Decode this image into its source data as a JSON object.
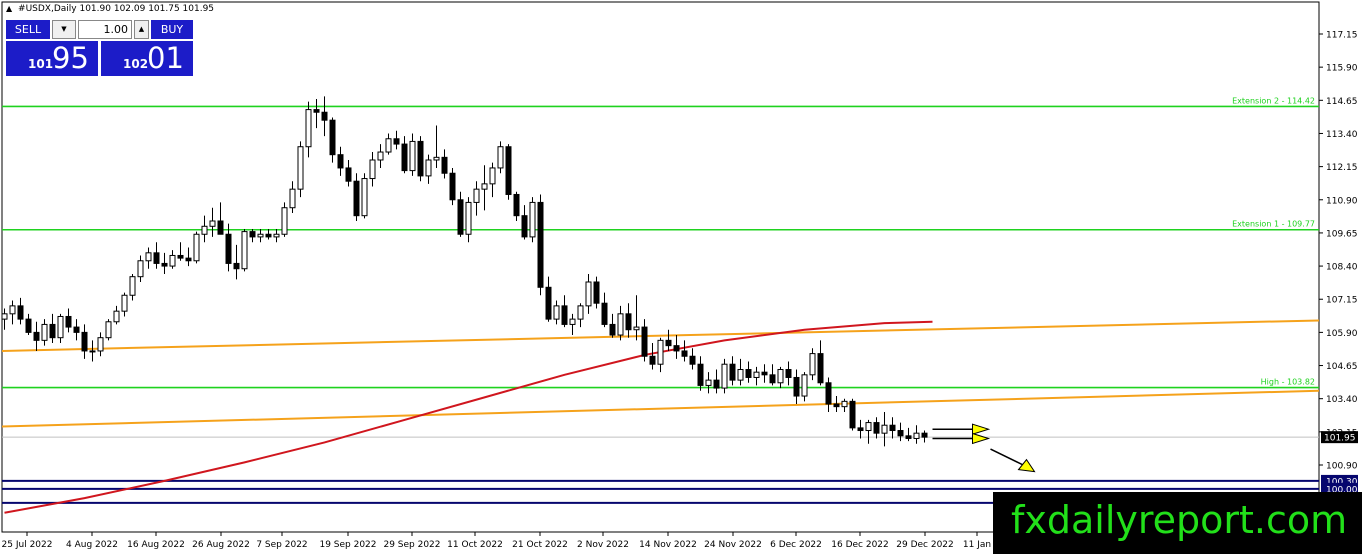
{
  "header": {
    "symbol_timeframe": "#USDX,Daily",
    "ohlc": "101.90 102.09 101.75 101.95"
  },
  "trade_panel": {
    "sell_label": "SELL",
    "buy_label": "BUY",
    "volume": "1.00",
    "bid_prefix": "101",
    "bid_big": "95",
    "ask_prefix": "102",
    "ask_big": "01"
  },
  "watermark": "fxdailyreport.com",
  "colors": {
    "background": "#ffffff",
    "candle": "#000000",
    "level_green": "#1fd21f",
    "trendline_orange": "#f5a21b",
    "moving_average_red": "#d0161e",
    "support_navy": "#06066e",
    "panel_blue": "#1c1cc8",
    "arrow_yellow": "#ffff00"
  },
  "chart_data": {
    "type": "candlestick",
    "symbol": "#USDX",
    "timeframe": "Daily",
    "current_price": 101.95,
    "ylim": [
      99.5,
      117.6
    ],
    "y_ticks": [
      117.15,
      115.9,
      114.65,
      113.4,
      112.15,
      110.9,
      109.65,
      108.4,
      107.15,
      105.9,
      104.65,
      103.4,
      102.15,
      100.9,
      100.3,
      100.0
    ],
    "y_tick_labels": [
      "117.15",
      "115.90",
      "114.65",
      "113.40",
      "112.15",
      "110.90",
      "109.65",
      "108.40",
      "107.15",
      "105.90",
      "104.65",
      "103.40",
      "102.15",
      "100.90",
      "100.30",
      "100.00",
      "101.95"
    ],
    "x_labels": [
      "25 Jul 2022",
      "4 Aug 2022",
      "16 Aug 2022",
      "26 Aug 2022",
      "7 Sep 2022",
      "19 Sep 2022",
      "29 Sep 2022",
      "11 Oct 2022",
      "21 Oct 2022",
      "2 Nov 2022",
      "14 Nov 2022",
      "24 Nov 2022",
      "6 Dec 2022",
      "16 Dec 2022",
      "29 Dec 2022",
      "11 Jan"
    ],
    "ohlc": [
      [
        106.4,
        106.8,
        106.0,
        106.6
      ],
      [
        106.6,
        107.1,
        106.2,
        106.9
      ],
      [
        106.9,
        107.2,
        106.2,
        106.4
      ],
      [
        106.4,
        106.6,
        105.8,
        105.9
      ],
      [
        105.9,
        106.3,
        105.2,
        105.6
      ],
      [
        105.6,
        106.4,
        105.4,
        106.2
      ],
      [
        106.2,
        106.6,
        105.5,
        105.7
      ],
      [
        105.7,
        106.6,
        105.5,
        106.5
      ],
      [
        106.5,
        106.8,
        105.9,
        106.1
      ],
      [
        106.1,
        106.4,
        105.6,
        105.9
      ],
      [
        105.9,
        106.2,
        104.9,
        105.2
      ],
      [
        105.2,
        105.6,
        104.8,
        105.2
      ],
      [
        105.2,
        105.9,
        105.0,
        105.7
      ],
      [
        105.7,
        106.4,
        105.6,
        106.3
      ],
      [
        106.3,
        106.9,
        106.2,
        106.7
      ],
      [
        106.7,
        107.4,
        106.5,
        107.3
      ],
      [
        107.3,
        108.1,
        107.1,
        108.0
      ],
      [
        108.0,
        108.8,
        107.8,
        108.6
      ],
      [
        108.6,
        109.1,
        108.3,
        108.9
      ],
      [
        108.9,
        109.3,
        108.3,
        108.5
      ],
      [
        108.5,
        108.9,
        108.1,
        108.4
      ],
      [
        108.4,
        109.0,
        108.3,
        108.8
      ],
      [
        108.8,
        109.3,
        108.6,
        108.7
      ],
      [
        108.7,
        109.1,
        108.4,
        108.6
      ],
      [
        108.6,
        109.7,
        108.5,
        109.6
      ],
      [
        109.6,
        110.3,
        109.3,
        109.9
      ],
      [
        109.9,
        110.6,
        109.5,
        110.1
      ],
      [
        110.1,
        110.8,
        109.8,
        109.6
      ],
      [
        109.6,
        110.0,
        108.2,
        108.5
      ],
      [
        108.5,
        109.2,
        107.9,
        108.3
      ],
      [
        108.3,
        109.8,
        108.2,
        109.7
      ],
      [
        109.7,
        109.8,
        109.3,
        109.5
      ],
      [
        109.5,
        109.8,
        109.3,
        109.6
      ],
      [
        109.6,
        109.8,
        109.4,
        109.5
      ],
      [
        109.5,
        109.8,
        109.3,
        109.6
      ],
      [
        109.6,
        110.8,
        109.5,
        110.6
      ],
      [
        110.6,
        111.6,
        110.4,
        111.3
      ],
      [
        111.3,
        113.1,
        111.0,
        112.9
      ],
      [
        112.9,
        114.6,
        112.5,
        114.3
      ],
      [
        114.3,
        114.7,
        113.6,
        114.2
      ],
      [
        114.2,
        114.8,
        113.3,
        113.9
      ],
      [
        113.9,
        114.0,
        112.3,
        112.6
      ],
      [
        112.6,
        112.9,
        111.8,
        112.1
      ],
      [
        112.1,
        112.4,
        111.4,
        111.6
      ],
      [
        111.6,
        111.9,
        110.1,
        110.3
      ],
      [
        110.3,
        111.9,
        110.2,
        111.7
      ],
      [
        111.7,
        112.7,
        111.4,
        112.4
      ],
      [
        112.4,
        113.0,
        112.1,
        112.7
      ],
      [
        112.7,
        113.4,
        112.6,
        113.2
      ],
      [
        113.2,
        113.5,
        112.8,
        113.0
      ],
      [
        113.0,
        113.3,
        111.9,
        112.0
      ],
      [
        112.0,
        113.4,
        111.8,
        113.1
      ],
      [
        113.1,
        113.3,
        111.6,
        111.8
      ],
      [
        111.8,
        112.6,
        111.5,
        112.4
      ],
      [
        112.4,
        113.7,
        112.1,
        112.5
      ],
      [
        112.5,
        112.8,
        111.7,
        111.9
      ],
      [
        111.9,
        112.1,
        110.7,
        110.9
      ],
      [
        110.9,
        111.2,
        109.5,
        109.6
      ],
      [
        109.6,
        111.0,
        109.3,
        110.8
      ],
      [
        110.8,
        111.6,
        110.3,
        111.3
      ],
      [
        111.3,
        112.2,
        110.5,
        111.5
      ],
      [
        111.5,
        112.3,
        111.0,
        112.1
      ],
      [
        112.1,
        113.1,
        111.9,
        112.9
      ],
      [
        112.9,
        113.0,
        110.9,
        111.1
      ],
      [
        111.1,
        111.2,
        110.1,
        110.3
      ],
      [
        110.3,
        110.7,
        109.4,
        109.5
      ],
      [
        109.5,
        111.0,
        109.3,
        110.8
      ],
      [
        110.8,
        111.1,
        107.3,
        107.6
      ],
      [
        107.6,
        108.0,
        106.3,
        106.4
      ],
      [
        106.4,
        107.1,
        106.2,
        106.9
      ],
      [
        106.9,
        107.3,
        106.1,
        106.2
      ],
      [
        106.2,
        106.6,
        105.8,
        106.4
      ],
      [
        106.4,
        107.0,
        106.1,
        106.9
      ],
      [
        106.9,
        108.1,
        106.6,
        107.8
      ],
      [
        107.8,
        108.0,
        106.8,
        107.0
      ],
      [
        107.0,
        107.4,
        106.1,
        106.2
      ],
      [
        106.2,
        106.6,
        105.7,
        105.8
      ],
      [
        105.8,
        106.9,
        105.6,
        106.6
      ],
      [
        106.6,
        107.0,
        105.7,
        106.0
      ],
      [
        106.0,
        107.3,
        105.6,
        106.1
      ],
      [
        106.1,
        106.4,
        104.8,
        105.0
      ],
      [
        105.0,
        105.5,
        104.5,
        104.7
      ],
      [
        104.7,
        105.7,
        104.4,
        105.6
      ],
      [
        105.6,
        106.0,
        105.2,
        105.4
      ],
      [
        105.4,
        105.8,
        104.9,
        105.2
      ],
      [
        105.2,
        105.6,
        104.8,
        105.0
      ],
      [
        105.0,
        105.3,
        104.5,
        104.7
      ],
      [
        104.7,
        105.0,
        103.7,
        103.9
      ],
      [
        103.9,
        104.4,
        103.6,
        104.1
      ],
      [
        104.1,
        104.5,
        103.6,
        103.8
      ],
      [
        103.8,
        104.9,
        103.6,
        104.7
      ],
      [
        104.7,
        105.0,
        103.9,
        104.1
      ],
      [
        104.1,
        104.9,
        103.9,
        104.5
      ],
      [
        104.5,
        104.8,
        104.0,
        104.2
      ],
      [
        104.2,
        104.6,
        103.9,
        104.4
      ],
      [
        104.4,
        104.7,
        104.0,
        104.3
      ],
      [
        104.3,
        104.7,
        103.9,
        104.0
      ],
      [
        104.0,
        104.6,
        103.8,
        104.5
      ],
      [
        104.5,
        104.8,
        103.9,
        104.2
      ],
      [
        104.2,
        104.5,
        103.2,
        103.5
      ],
      [
        103.5,
        104.4,
        103.3,
        104.3
      ],
      [
        104.3,
        105.3,
        104.1,
        105.1
      ],
      [
        105.1,
        105.6,
        103.9,
        104.0
      ],
      [
        104.0,
        104.2,
        102.9,
        103.2
      ],
      [
        103.2,
        103.5,
        102.9,
        103.1
      ],
      [
        103.1,
        103.4,
        102.9,
        103.3
      ],
      [
        103.3,
        103.4,
        102.2,
        102.3
      ],
      [
        102.3,
        102.6,
        101.9,
        102.2
      ],
      [
        102.2,
        102.6,
        101.7,
        102.5
      ],
      [
        102.5,
        102.7,
        101.9,
        102.1
      ],
      [
        102.1,
        102.9,
        101.6,
        102.4
      ],
      [
        102.4,
        102.7,
        101.9,
        102.2
      ],
      [
        102.2,
        102.5,
        101.8,
        102.0
      ],
      [
        102.0,
        102.3,
        101.8,
        101.9
      ],
      [
        101.9,
        102.4,
        101.7,
        102.1
      ],
      [
        102.1,
        102.2,
        101.75,
        101.95
      ]
    ],
    "horizontal_levels": [
      {
        "label": "Extension 2 - 114.42",
        "value": 114.42,
        "color": "green"
      },
      {
        "label": "Extension 1 - 109.77",
        "value": 109.77,
        "color": "green"
      },
      {
        "label": "High - 103.82",
        "value": 103.82,
        "color": "green"
      },
      {
        "value": 101.95,
        "color": "grey"
      },
      {
        "value": 100.3,
        "color": "navy"
      },
      {
        "value": 100.0,
        "color": "navy"
      },
      {
        "value": 99.47,
        "color": "navy"
      }
    ],
    "trendlines": [
      {
        "color": "orange",
        "from": {
          "bar": 0,
          "value": 105.2
        },
        "to": {
          "bar": "right-edge",
          "value": 106.35
        }
      },
      {
        "color": "orange",
        "from": {
          "bar": 0,
          "value": 102.35
        },
        "to": {
          "bar": "right-edge",
          "value": 103.7
        }
      }
    ],
    "moving_average": {
      "color": "red",
      "points": [
        [
          0,
          99.1
        ],
        [
          10,
          99.65
        ],
        [
          20,
          100.3
        ],
        [
          30,
          101.0
        ],
        [
          40,
          101.75
        ],
        [
          50,
          102.6
        ],
        [
          60,
          103.45
        ],
        [
          70,
          104.3
        ],
        [
          80,
          105.05
        ],
        [
          90,
          105.6
        ],
        [
          100,
          106.0
        ],
        [
          110,
          106.25
        ],
        [
          116,
          106.3
        ]
      ]
    },
    "annotations": [
      {
        "type": "arrow",
        "direction": "right",
        "color": "yellow"
      },
      {
        "type": "arrow",
        "direction": "right",
        "color": "yellow"
      },
      {
        "type": "arrow",
        "direction": "down-right",
        "color": "yellow"
      }
    ],
    "grid": false
  }
}
